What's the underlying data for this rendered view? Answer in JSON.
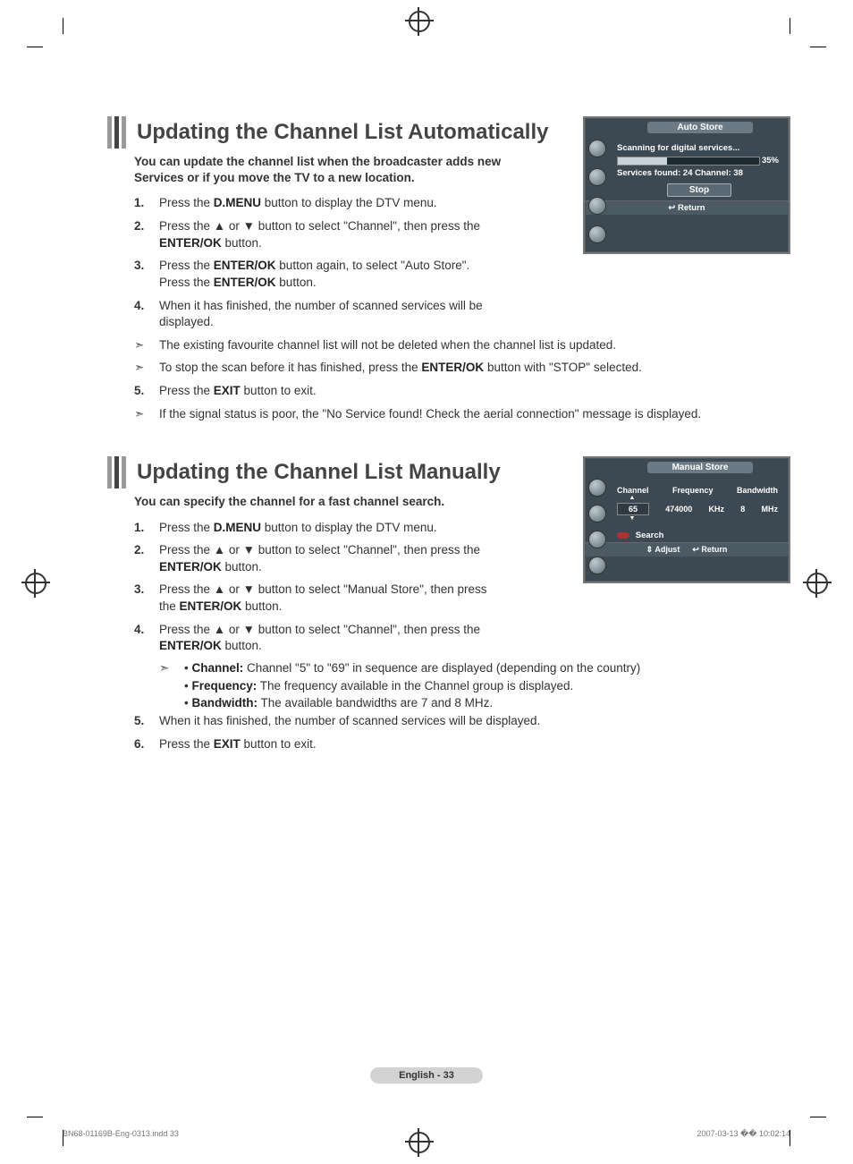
{
  "page": {
    "footer_label": "English - 33",
    "imprint_file": "BN68-01169B-Eng-0313.indd   33",
    "imprint_time": "2007-03-13   �� 10:02:14"
  },
  "section_auto": {
    "title": "Updating the Channel List Automatically",
    "intro": "You can update the channel list when the broadcaster adds new Services or if you move the TV to a new location.",
    "steps": [
      {
        "n": "1.",
        "pre": "Press the ",
        "b": "D.MENU",
        "post": " button to display the DTV menu.",
        "wide": false
      },
      {
        "n": "2.",
        "pre": "Press the ▲ or ▼ button to select \"Channel\", then press the ",
        "b": "ENTER/OK",
        "post": " button.",
        "wide": false
      },
      {
        "n": "3.",
        "pre": "Press the ",
        "b": "ENTER/OK",
        "post": " button again, to select \"Auto Store\". Press the ",
        "b2": "ENTER/OK",
        "post2": " button.",
        "wide": false
      },
      {
        "n": "4.",
        "pre": "When it has finished, the number of scanned services will be displayed.",
        "wide": false
      }
    ],
    "notes": [
      "The existing favourite channel list will not be deleted when the channel list is updated.",
      "To stop the scan before it has finished, press the <b>ENTER/OK</b> button with \"STOP\" selected."
    ],
    "step5": {
      "n": "5.",
      "pre": "Press the ",
      "b": "EXIT",
      "post": " button to exit."
    },
    "note3": "If the signal status is poor, the \"No Service found! Check the aerial connection\" message is displayed."
  },
  "section_manual": {
    "title": "Updating the Channel List Manually",
    "intro": "You can specify the channel for a fast channel search.",
    "steps": [
      {
        "n": "1.",
        "pre": "Press the ",
        "b": "D.MENU",
        "post": " button to display the DTV menu."
      },
      {
        "n": "2.",
        "pre": "Press the ▲ or ▼ button to select \"Channel\", then press the ",
        "b": "ENTER/OK",
        "post": " button."
      },
      {
        "n": "3.",
        "pre": "Press the ▲ or ▼ button to select \"Manual Store\", then press the ",
        "b": "ENTER/OK",
        "post": " button."
      },
      {
        "n": "4.",
        "pre": "Press the ▲ or ▼ button to select \"Channel\", then press the ",
        "b": "ENTER/OK",
        "post": " button."
      }
    ],
    "bullets": [
      {
        "b": "Channel:",
        "t": " Channel \"5\" to \"69\" in sequence are displayed (depending on the country)"
      },
      {
        "b": "Frequency:",
        "t": " The frequency available in the Channel group is displayed."
      },
      {
        "b": "Bandwidth:",
        "t": " The available bandwidths are 7 and 8 MHz."
      }
    ],
    "step5": {
      "n": "5.",
      "t": "When it has finished, the number of scanned services will be displayed."
    },
    "step6": {
      "n": "6.",
      "pre": "Press the ",
      "b": "EXIT",
      "post": " button to exit."
    }
  },
  "osd_auto": {
    "title": "Auto Store",
    "status_line": "Scanning for digital services...",
    "percent": "35%",
    "found_line": "Services found: 24    Channel: 38",
    "stop_btn": "Stop",
    "return": "↩ Return"
  },
  "osd_manual": {
    "title": "Manual Store",
    "col_channel": "Channel",
    "col_freq": "Frequency",
    "col_bw": "Bandwidth",
    "val_channel": "65",
    "val_freq": "474000",
    "val_khz": "KHz",
    "val_bw": "8",
    "val_mhz": "MHz",
    "search": "Search",
    "adjust": "⇕ Adjust",
    "return": "↩ Return"
  }
}
